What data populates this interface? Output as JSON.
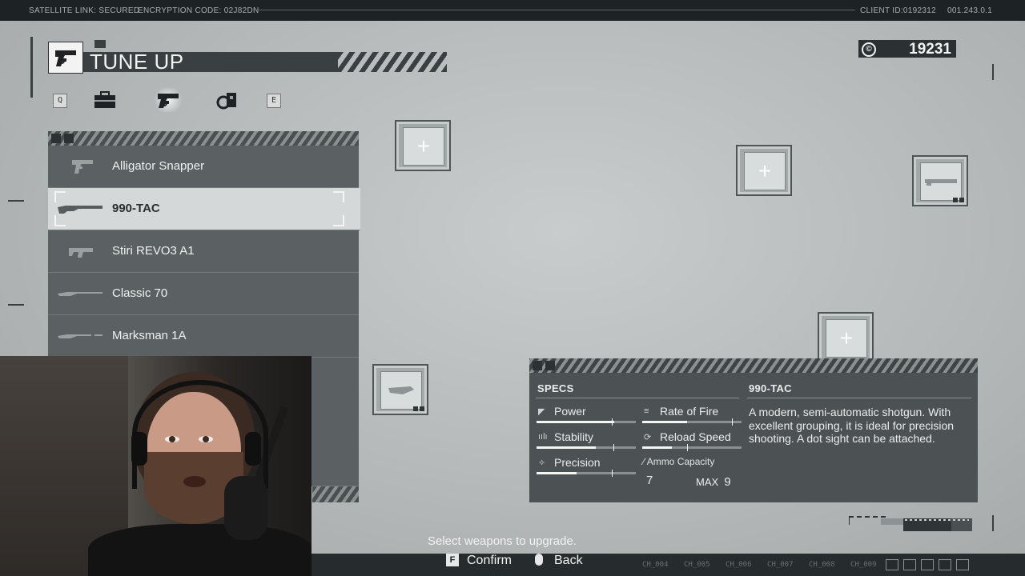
{
  "topbar": {
    "satellite": "SATELLITE LINK: SECURED",
    "encryption": "ENCRYPTION CODE: 02J82DN",
    "client": "CLIENT ID:0192312",
    "version": "001.243.0.1"
  },
  "header": {
    "title": "TUNE UP"
  },
  "currency": {
    "value": "19231",
    "symbol": "©"
  },
  "tabs": {
    "prev_key": "Q",
    "next_key": "E",
    "items": [
      {
        "icon": "briefcase-icon"
      },
      {
        "icon": "pistol-icon",
        "active": true
      },
      {
        "icon": "modules-icon"
      }
    ]
  },
  "weapons": [
    {
      "name": "Alligator Snapper",
      "icon": "pistol-icon"
    },
    {
      "name": "990-TAC",
      "icon": "shotgun-icon",
      "selected": true
    },
    {
      "name": "Stiri REVO3 A1",
      "icon": "smg-icon"
    },
    {
      "name": "Classic 70",
      "icon": "rifle-icon"
    },
    {
      "name": "Marksman 1A",
      "icon": "sniper-icon"
    }
  ],
  "specs": {
    "heading": "SPECS",
    "weapon_name": "990-TAC",
    "stats": [
      {
        "label": "Power",
        "icon": "power-icon",
        "value": 0.78
      },
      {
        "label": "Rate of Fire",
        "icon": "rate-of-fire-icon",
        "value": 0.45
      },
      {
        "label": "Stability",
        "icon": "stability-icon",
        "value": 0.6
      },
      {
        "label": "Reload Speed",
        "icon": "reload-icon",
        "value": 0.3
      },
      {
        "label": "Precision",
        "icon": "precision-icon",
        "value": 0.4
      }
    ],
    "ammo_label": "Ammo Capacity",
    "ammo_value": "7",
    "ammo_max_label": "MAX",
    "ammo_max_value": "9",
    "description": "A modern, semi-automatic shotgun. With excellent grouping, it is ideal for precision shooting. A dot sight can be attached."
  },
  "hint": "Select weapons to upgrade.",
  "controls": {
    "confirm_key": "F",
    "confirm_label": "Confirm",
    "back_label": "Back"
  },
  "channels": [
    "CH_004",
    "CH_005",
    "CH_006",
    "CH_007",
    "CH_008",
    "CH_009"
  ],
  "colors": {
    "panel": "#4c5254",
    "accent": "#f4f4f4",
    "dark": "#2b3033"
  }
}
